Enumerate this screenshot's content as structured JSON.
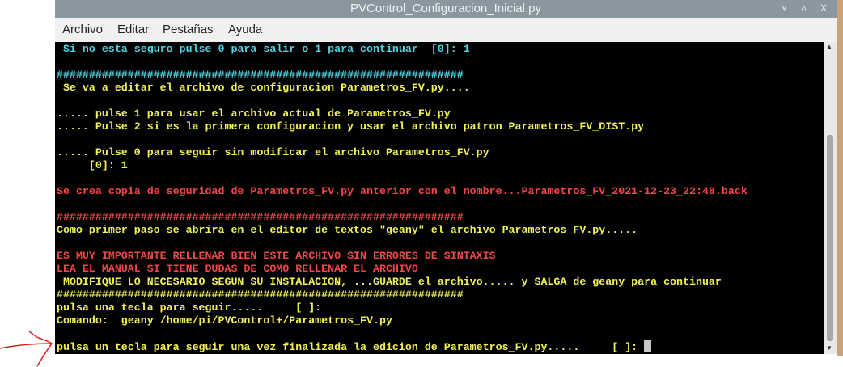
{
  "window": {
    "title": "PVControl_Configuracion_Inicial.py",
    "buttons": [
      "˅",
      "˄",
      "X"
    ]
  },
  "menu": [
    "Archivo",
    "Editar",
    "Pestañas",
    "Ayuda"
  ],
  "terminal": {
    "lines": [
      {
        "text": " Si no esta seguro pulse 0 para salir o 1 para continuar  [0]: 1",
        "color": "c"
      },
      {
        "text": "",
        "color": "c"
      },
      {
        "text": "###############################################################",
        "color": "c"
      },
      {
        "text": " Se va a editar el archivo de configuracion Parametros_FV.py....",
        "color": "y"
      },
      {
        "text": "",
        "color": "y"
      },
      {
        "text": "..... pulse 1 para usar el archivo actual de Parametros_FV.py",
        "color": "y"
      },
      {
        "text": "..... Pulse 2 si es la primera configuracion y usar el archivo patron Parametros_FV_DIST.py",
        "color": "y"
      },
      {
        "text": "",
        "color": "y"
      },
      {
        "text": "..... Pulse 0 para seguir sin modificar el archivo Parametros_FV.py",
        "color": "y"
      },
      {
        "text": "     [0]: 1",
        "color": "y"
      },
      {
        "text": "",
        "color": "y"
      },
      {
        "text": "Se crea copia de seguridad de Parametros_FV.py anterior con el nombre...Parametros_FV_2021-12-23_22:48.back",
        "color": "r"
      },
      {
        "text": "",
        "color": "r"
      },
      {
        "text": "###############################################################",
        "color": "r"
      },
      {
        "text": "Como primer paso se abrira en el editor de textos \"geany\" el archivo Parametros_FV.py.....",
        "color": "y"
      },
      {
        "text": "",
        "color": "y"
      },
      {
        "text": "ES MUY IMPORTANTE RELLENAR BIEN ESTE ARCHIVO SIN ERRORES DE SINTAXIS",
        "color": "r"
      },
      {
        "text": "LEA EL MANUAL SI TIENE DUDAS DE COMO RELLENAR EL ARCHIVO",
        "color": "r"
      },
      {
        "text": " MODIFIQUE LO NECESARIO SEGUN SU INSTALACION, ...GUARDE el archivo..... y SALGA de geany para continuar",
        "color": "y"
      },
      {
        "text": "###############################################################",
        "color": "y"
      },
      {
        "text": "pulsa una tecla para seguir.....     [ ]:",
        "color": "y"
      },
      {
        "text": "Comando:  geany /home/pi/PVControl+/Parametros_FV.py",
        "color": "y"
      },
      {
        "text": "",
        "color": "y"
      },
      {
        "text": "pulsa un tecla para seguir una vez finalizada la edicion de Parametros_FV.py.....     [ ]: ",
        "color": "y"
      }
    ]
  }
}
